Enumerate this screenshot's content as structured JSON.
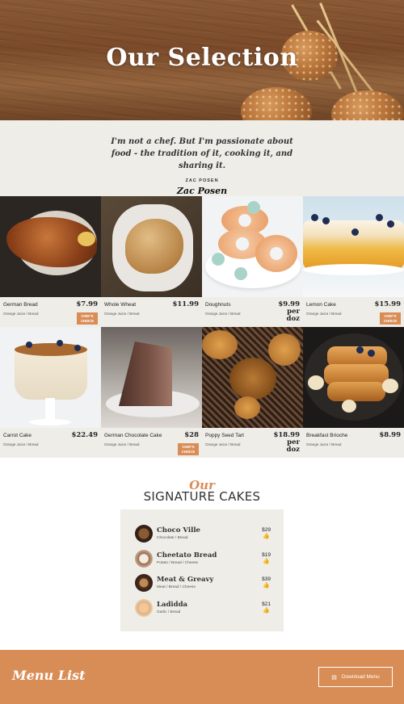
{
  "hero": {
    "title": "Our Selection"
  },
  "quote": {
    "text": "I'm not a chef. But I'm passionate about food - the tradition of it, cooking it, and sharing it.",
    "author": "ZAC POSEN",
    "signature": "Zac Posen"
  },
  "menu": {
    "items": [
      {
        "name": "German Bread",
        "sub": "Orange Juice / Bread",
        "price": "$7.99",
        "badge": "CHEF'S CHOICE"
      },
      {
        "name": "Whole Wheat",
        "sub": "Orange Juice / Bread",
        "price": "$11.99"
      },
      {
        "name": "Doughnuts",
        "sub": "Orange Juice / Bread",
        "price": "$9.99 per doz"
      },
      {
        "name": "Lemon Cake",
        "sub": "Orange Juice / Bread",
        "price": "$15.99",
        "badge": "CHEF'S CHOICE"
      },
      {
        "name": "Carrot Cake",
        "sub": "Orange Juice / Bread",
        "price": "$22.49"
      },
      {
        "name": "German Chocolate Cake",
        "sub": "Orange Juice / Bread",
        "price": "$28",
        "badge": "CHEF'S CHOICE"
      },
      {
        "name": "Poppy Seed Tart",
        "sub": "Orange Juice / Bread",
        "price": "$18.99 per doz"
      },
      {
        "name": "Breakfast Brioche",
        "sub": "Orange Juice / Bread",
        "price": "$8.99"
      }
    ]
  },
  "signature": {
    "script": "Our",
    "heading": "SIGNATURE CAKES",
    "items": [
      {
        "name": "Choco Ville",
        "sub": "Chocolate / Bread",
        "price": "$29",
        "like_icon": "thumbs-up-icon"
      },
      {
        "name": "Cheetato Bread",
        "sub": "Potato / Bread / Cheese",
        "price": "$19",
        "like_icon": "thumbs-up-icon"
      },
      {
        "name": "Meat & Greavy",
        "sub": "Meat / Bread / Cheese",
        "price": "$39",
        "like_icon": "thumbs-up-icon"
      },
      {
        "name": "Ladidda",
        "sub": "Garlic / Bread",
        "price": "$21",
        "like_icon": "thumbs-up-icon"
      }
    ]
  },
  "footer": {
    "title": "Menu List",
    "download_label": "Download Menu",
    "download_icon": "document-icon"
  },
  "colors": {
    "accent": "#d98d56",
    "panel": "#efede8",
    "text": "#222222"
  }
}
